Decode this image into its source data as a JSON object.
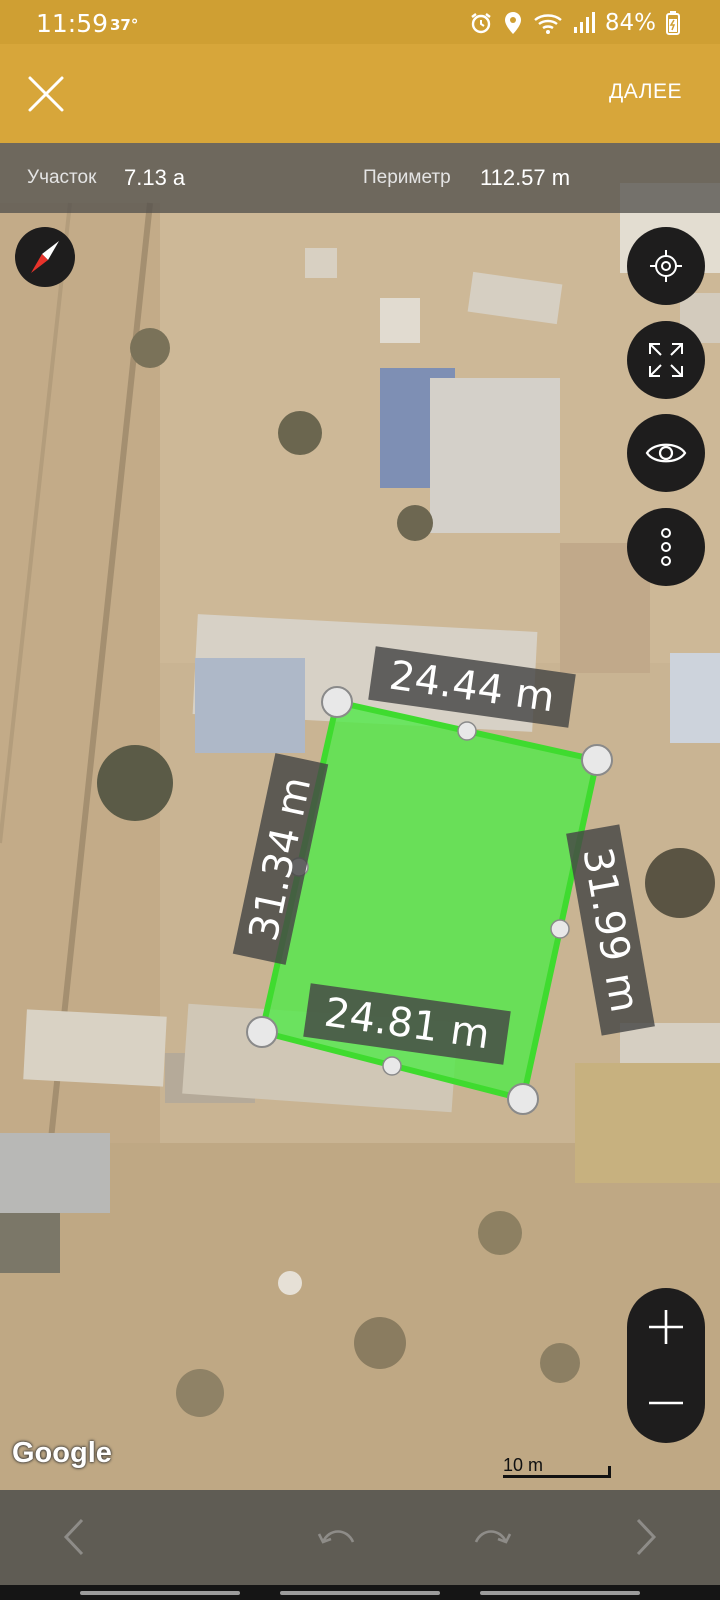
{
  "status_bar": {
    "time": "11:59",
    "temperature": "37°",
    "battery": "84%"
  },
  "app_bar": {
    "next_label": "ДАЛЕЕ"
  },
  "info_bar": {
    "area_label": "Участок",
    "area_value": "7.13 а",
    "perimeter_label": "Периметр",
    "perimeter_value": "112.57 m"
  },
  "measurements": {
    "top": "24.44 m",
    "left": "31.34 m",
    "right": "31.99 m",
    "bottom": "24.81 m"
  },
  "map": {
    "attribution": "Google",
    "scale_label": "10 m"
  },
  "colors": {
    "accent": "#d7a63a",
    "status_bar": "#cf9f33",
    "plot_fill": "#54e84c",
    "plot_stroke": "#3fdb2f"
  }
}
